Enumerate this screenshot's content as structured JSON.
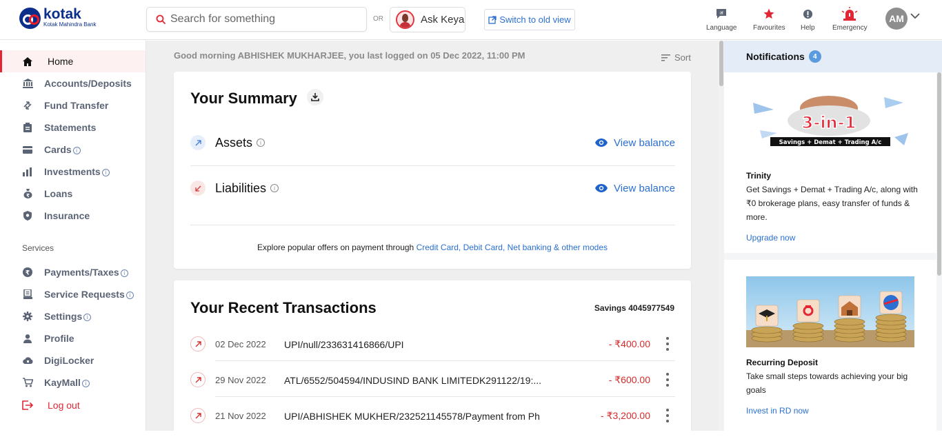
{
  "header": {
    "brand_name": "kotak",
    "brand_sub": "Kotak Mahindra Bank",
    "search_placeholder": "Search for something",
    "or_label": "OR",
    "ask_keya_label": "Ask Keya",
    "switch_view_label": "Switch to old view",
    "tools": [
      {
        "label": "Language",
        "icon": "language-icon"
      },
      {
        "label": "Favourites",
        "icon": "star-icon"
      },
      {
        "label": "Help",
        "icon": "help-icon"
      },
      {
        "label": "Emergency",
        "icon": "emergency-icon"
      }
    ],
    "avatar_initials": "AM"
  },
  "sidebar": {
    "items": [
      {
        "label": "Home",
        "icon": "home-icon",
        "active": true
      },
      {
        "label": "Accounts/Deposits",
        "icon": "bank-icon"
      },
      {
        "label": "Fund Transfer",
        "icon": "transfer-icon"
      },
      {
        "label": "Statements",
        "icon": "clipboard-icon"
      },
      {
        "label": "Cards",
        "icon": "card-icon",
        "info": true
      },
      {
        "label": "Investments",
        "icon": "bar-chart-icon",
        "info": true
      },
      {
        "label": "Loans",
        "icon": "money-bag-icon"
      },
      {
        "label": "Insurance",
        "icon": "shield-icon"
      }
    ],
    "services_heading": "Services",
    "services": [
      {
        "label": "Payments/Taxes",
        "icon": "rupee-icon",
        "info": true
      },
      {
        "label": "Service Requests",
        "icon": "receipt-icon",
        "info": true
      },
      {
        "label": "Settings",
        "icon": "gear-icon",
        "info": true
      },
      {
        "label": "Profile",
        "icon": "person-icon"
      },
      {
        "label": "DigiLocker",
        "icon": "cloud-lock-icon"
      },
      {
        "label": "KayMall",
        "icon": "cart-icon",
        "info": true
      }
    ],
    "logout_label": "Log out"
  },
  "main": {
    "greeting": "Good morning ABHISHEK MUKHARJEE, you last logged on 05 Dec 2022, 11:00 PM",
    "sort_label": "Sort",
    "summary": {
      "title": "Your Summary",
      "assets_label": "Assets",
      "liabilities_label": "Liabilities",
      "view_balance_label": "View balance",
      "offers_text": "Explore popular offers on payment through ",
      "offers_link": "Credit Card, Debit Card, Net banking & other modes"
    },
    "transactions": {
      "title": "Your Recent Transactions",
      "account": "Savings 4045977549",
      "rows": [
        {
          "date": "02 Dec 2022",
          "desc": "UPI/null/233631416866/UPI",
          "amount": "- ₹400.00"
        },
        {
          "date": "29 Nov 2022",
          "desc": "ATL/6552/504594/INDUSIND BANK LIMITEDK291122/19:...",
          "amount": "- ₹600.00"
        },
        {
          "date": "21 Nov 2022",
          "desc": "UPI/ABHISHEK MUKHER/232521145578/Payment from Ph",
          "amount": "- ₹3,200.00"
        }
      ]
    }
  },
  "notifications": {
    "title": "Notifications",
    "count": "4",
    "items": [
      {
        "banner_text": "3-in-1",
        "banner_sub": "Savings + Demat + Trading A/c",
        "heading": "Trinity",
        "body": "Get Savings + Demat + Trading A/c, along with ₹0 brokerage plans, easy transfer of funds & more.",
        "link": "Upgrade now"
      },
      {
        "heading": "Recurring Deposit",
        "body": "Take small steps towards achieving your big goals",
        "link": "Invest in RD now"
      }
    ]
  },
  "colors": {
    "brand_blue": "#0b2e8a",
    "accent_red": "#e32636",
    "link_blue": "#2a6fd1"
  }
}
